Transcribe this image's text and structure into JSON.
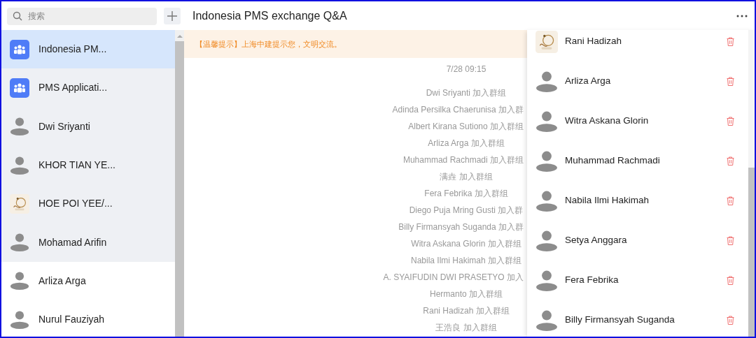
{
  "search": {
    "placeholder": "搜索"
  },
  "title": "Indonesia PMS exchange Q&A",
  "conversations": [
    {
      "name": "Indonesia PM...",
      "kind": "group",
      "selected": true,
      "pinned": true
    },
    {
      "name": "PMS Applicati...",
      "kind": "group",
      "selected": false,
      "pinned": true
    },
    {
      "name": "Dwi Sriyanti",
      "kind": "person",
      "selected": false,
      "pinned": true
    },
    {
      "name": "KHOR TIAN YE...",
      "kind": "person",
      "selected": false,
      "pinned": true
    },
    {
      "name": "HOE POI YEE/...",
      "kind": "picture",
      "selected": false,
      "pinned": true
    },
    {
      "name": "Mohamad Arifin",
      "kind": "person",
      "selected": false,
      "pinned": true
    },
    {
      "name": "Arliza Arga",
      "kind": "person",
      "selected": false,
      "pinned": false
    },
    {
      "name": "Nurul Fauziyah",
      "kind": "person",
      "selected": false,
      "pinned": false
    }
  ],
  "notice": "【温馨提示】上海中建提示您，文明交流。",
  "timestamp": "7/28 09:15",
  "system_messages": [
    "Dwi Sriyanti 加入群组",
    "Adinda Persilka Chaerunisa 加入群",
    "Albert Kirana Sutiono 加入群组",
    "Arliza Arga 加入群组",
    "Muhammad Rachmadi 加入群组",
    "满垚 加入群组",
    "Fera Febrika 加入群组",
    "Diego Puja Mring Gusti 加入群",
    "Billy Firmansyah Suganda 加入群",
    "Witra Askana Glorin 加入群组",
    "Nabila Ilmi Hakimah 加入群组",
    "A. SYAIFUDIN DWI PRASETYO 加入",
    "Hermanto 加入群组",
    "Rani Hadizah 加入群组",
    "王浩良 加入群组"
  ],
  "members": [
    {
      "name": "Rani Hadizah",
      "kind": "picture"
    },
    {
      "name": "Arliza Arga",
      "kind": "person"
    },
    {
      "name": "Witra Askana Glorin",
      "kind": "person"
    },
    {
      "name": "Muhammad Rachmadi",
      "kind": "person"
    },
    {
      "name": "Nabila Ilmi Hakimah",
      "kind": "person"
    },
    {
      "name": "Setya Anggara",
      "kind": "person"
    },
    {
      "name": "Fera Febrika",
      "kind": "person"
    },
    {
      "name": "Billy Firmansyah Suganda",
      "kind": "person"
    }
  ]
}
